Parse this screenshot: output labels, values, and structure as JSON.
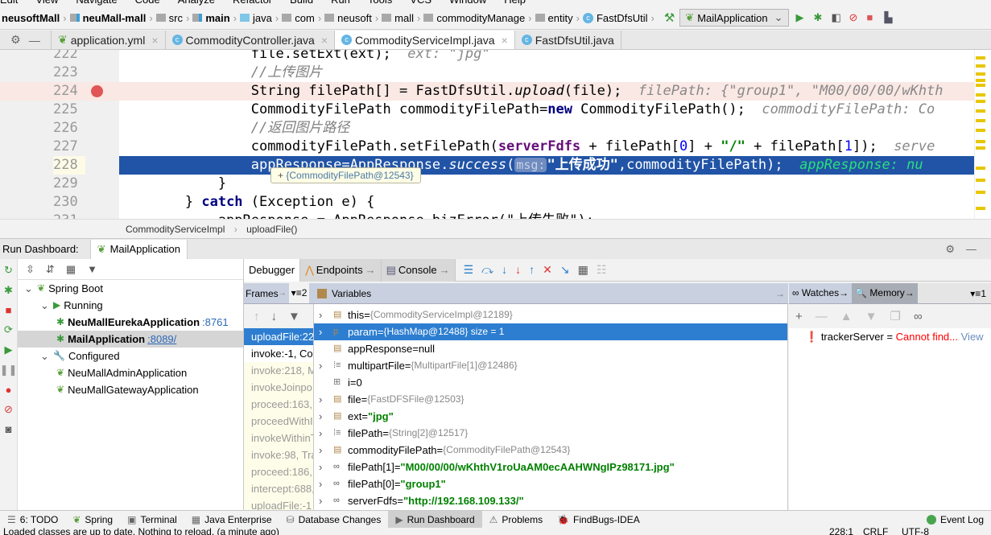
{
  "menu": [
    "Edit",
    "View",
    "Navigate",
    "Code",
    "Analyze",
    "Refactor",
    "Build",
    "Run",
    "Tools",
    "VCS",
    "Window",
    "Help"
  ],
  "nav": {
    "crumbs": [
      "neusoftMall",
      "neuMall-mall",
      "src",
      "main",
      "java",
      "com",
      "neusoft",
      "mall",
      "commodityManage",
      "entity",
      "FastDfsUtil"
    ],
    "run_config": "MailApplication"
  },
  "tabs": [
    {
      "label": "application.yml"
    },
    {
      "label": "CommodityController.java"
    },
    {
      "label": "CommodityServiceImpl.java",
      "active": true
    },
    {
      "label": "FastDfsUtil.java"
    }
  ],
  "editor": {
    "lines": [
      {
        "n": "222",
        "code": "                file.setExt(ext);",
        "hint": "  ext: \"jpg\""
      },
      {
        "n": "223",
        "comment": "                //上传图片"
      },
      {
        "n": "224",
        "pre": "                String filePath[] = FastDfsUtil.",
        "method": "upload",
        "post": "(file);",
        "hint": "  filePath: {\"group1\", \"M00/00/00/wKhth"
      },
      {
        "n": "225",
        "pre": "                CommodityFilePath commodityFilePath=",
        "kw": "new",
        "post": " CommodityFilePath();",
        "hint": "  commodityFilePath: Co"
      },
      {
        "n": "226",
        "comment": "                //返回图片路径"
      },
      {
        "n": "227",
        "pre": "                commodityFilePath.setFilePath(",
        "field": "serverFdfs",
        "mid": " + filePath[",
        "n0": "0",
        "mid2": "] + ",
        "s": "\"/\"",
        "mid3": " + filePath[",
        "n1": "1",
        "post": "]);",
        "hint": "  serve"
      },
      {
        "n": "228",
        "pre": "                appResponse=AppResponse.",
        "method": "success",
        "param": "msg:",
        "str": "\"上传成功\"",
        "post": ",commodityFilePath);",
        "hint": "  appResponse: nu"
      },
      {
        "n": "229",
        "code": "            }"
      },
      {
        "n": "230",
        "pre": "        } ",
        "kw": "catch",
        "post": " (Exception e) {"
      },
      {
        "n": "231",
        "code": "            appResponse = AppResponse.bizError(\"上传失败\");"
      }
    ],
    "tooltip": "{CommodityFilePath@12543}",
    "breadcrumb": [
      "CommodityServiceImpl",
      "uploadFile()"
    ]
  },
  "run_dashboard": {
    "title": "Run Dashboard:",
    "config": "MailApplication",
    "tree": [
      {
        "label": "Spring Boot",
        "level": 0
      },
      {
        "label": "Running",
        "level": 1
      },
      {
        "label": "NeuMallEurekaApplication",
        "port": ":8761",
        "level": 2
      },
      {
        "label": "MailApplication",
        "port": ":8089/",
        "level": 2,
        "selected": true
      },
      {
        "label": "Configured",
        "level": 1
      },
      {
        "label": "NeuMallAdminApplication",
        "level": 2
      },
      {
        "label": "NeuMallGatewayApplication",
        "level": 2
      }
    ]
  },
  "debugger": {
    "tabs": [
      "Debugger",
      "Endpoints",
      "Console"
    ],
    "frames_label": "Frames",
    "threads_count": "2",
    "variables_label": "Variables",
    "frames": [
      "uploadFile:228",
      "invoke:-1, Co",
      "invoke:218, M",
      "invokeJoinpo",
      "proceed:163,",
      "proceedWithI",
      "invokeWithinT",
      "invoke:98, Tra",
      "proceed:186,",
      "intercept:688,",
      "uploadFile:-1"
    ],
    "variables": [
      {
        "name": "this",
        "value": "{CommodityServiceImpl@12189}",
        "icon": "field",
        "exp": true
      },
      {
        "name": "param",
        "value": "{HashMap@12488}  size = 1",
        "icon": "param",
        "exp": true,
        "selected": true
      },
      {
        "name": "appResponse",
        "value": "null",
        "icon": "field"
      },
      {
        "name": "multipartFile",
        "value": "{MultipartFile[1]@12486}",
        "icon": "array",
        "exp": true
      },
      {
        "name": "i",
        "value": "0",
        "icon": "prim"
      },
      {
        "name": "file",
        "value": "{FastDFSFile@12503}",
        "icon": "field",
        "exp": true
      },
      {
        "name": "ext",
        "value": "\"jpg\"",
        "icon": "field",
        "exp": true,
        "str": true
      },
      {
        "name": "filePath",
        "value": "{String[2]@12517}",
        "icon": "array",
        "exp": true
      },
      {
        "name": "commodityFilePath",
        "value": "{CommodityFilePath@12543}",
        "icon": "field",
        "exp": true
      },
      {
        "name": "filePath[1]",
        "value": "\"M00/00/00/wKhthV1roUaAM0ecAAHWNgIPz98171.jpg\"",
        "icon": "watch",
        "exp": true,
        "str": true
      },
      {
        "name": "filePath[0]",
        "value": "\"group1\"",
        "icon": "watch",
        "exp": true,
        "str": true
      },
      {
        "name": "serverFdfs",
        "value": "\"http://192.168.109.133/\"",
        "icon": "watch",
        "exp": true,
        "str": true
      }
    ],
    "watches_label": "Watches",
    "memory_label": "Memory",
    "watch_count": "1",
    "watch_item": {
      "name": "trackerServer",
      "eq": " = ",
      "error": "Cannot find...",
      "link": "View"
    }
  },
  "bottom_tools": [
    "6: TODO",
    "Spring",
    "Terminal",
    "Java Enterprise",
    "Database Changes",
    "Run Dashboard",
    "Problems",
    "FindBugs-IDEA"
  ],
  "event_log": "Event Log",
  "status": {
    "message": "Loaded classes are up to date. Nothing to reload. (a minute ago)",
    "position": "228:1",
    "line_sep": "CRLF",
    "encoding": "UTF-8"
  }
}
